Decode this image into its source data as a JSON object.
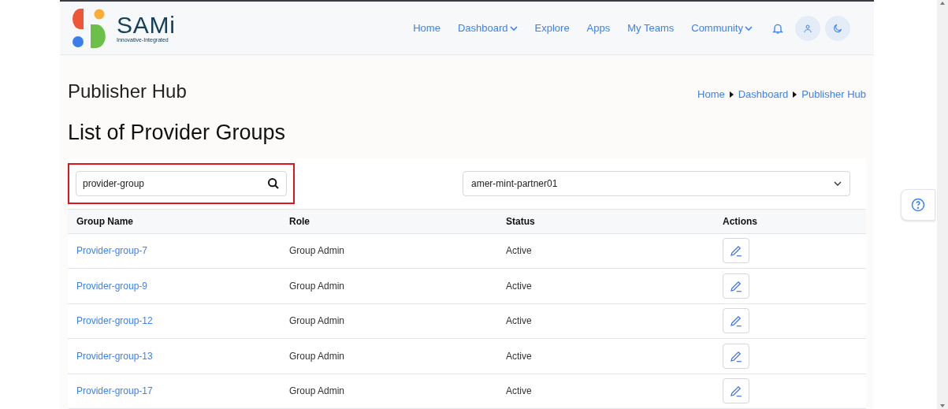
{
  "logo": {
    "name": "SAMi",
    "tagline": "Innovative-Integrated"
  },
  "nav": [
    {
      "label": "Home",
      "has_menu": false
    },
    {
      "label": "Dashboard",
      "has_menu": true
    },
    {
      "label": "Explore",
      "has_menu": false
    },
    {
      "label": "Apps",
      "has_menu": false
    },
    {
      "label": "My Teams",
      "has_menu": false
    },
    {
      "label": "Community",
      "has_menu": true
    }
  ],
  "page_title": "Publisher Hub",
  "breadcrumb": [
    "Home",
    "Dashboard",
    "Publisher Hub"
  ],
  "heading": "List of Provider Groups",
  "search": {
    "value": "provider-group"
  },
  "partner_select": {
    "value": "amer-mint-partner01"
  },
  "table": {
    "columns": [
      "Group Name",
      "Role",
      "Status",
      "Actions"
    ],
    "rows": [
      {
        "name": "Provider-group-7",
        "role": "Group Admin",
        "status": "Active"
      },
      {
        "name": "Provider-group-9",
        "role": "Group Admin",
        "status": "Active"
      },
      {
        "name": "Provider-group-12",
        "role": "Group Admin",
        "status": "Active"
      },
      {
        "name": "Provider-group-13",
        "role": "Group Admin",
        "status": "Active"
      },
      {
        "name": "Provider-group-17",
        "role": "Group Admin",
        "status": "Active"
      }
    ]
  }
}
